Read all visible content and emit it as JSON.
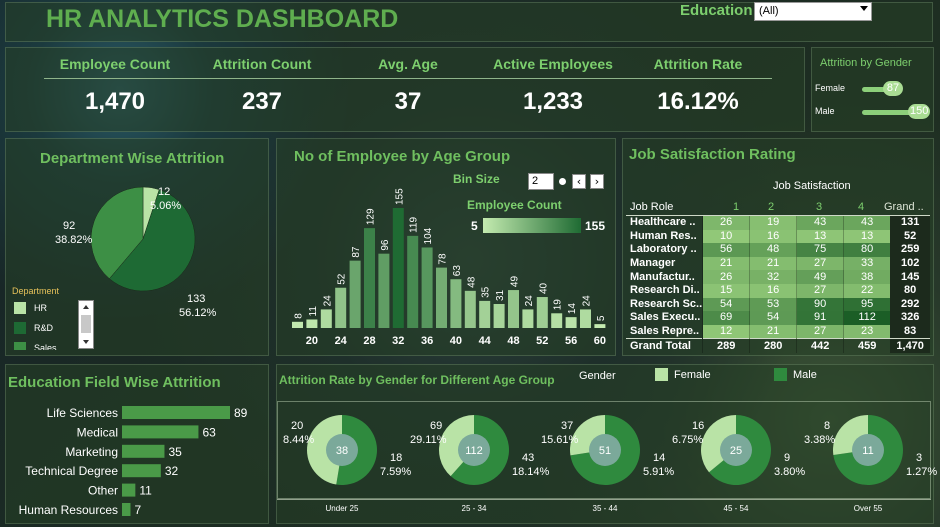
{
  "header": {
    "title": "HR ANALYTICS DASHBOARD",
    "filter_label": "Education",
    "filter_value": "(All)"
  },
  "kpis": [
    {
      "label": "Employee Count",
      "value": "1,470"
    },
    {
      "label": "Attrition Count",
      "value": "237"
    },
    {
      "label": "Avg. Age",
      "value": "37"
    },
    {
      "label": "Active Employees",
      "value": "1,233"
    },
    {
      "label": "Attrition Rate",
      "value": "16.12%"
    }
  ],
  "gender_panel": {
    "title": "Attrition by Gender",
    "rows": [
      {
        "label": "Female",
        "value": 87
      },
      {
        "label": "Male",
        "value": 150
      }
    ],
    "max": 150
  },
  "department": {
    "title": "Department Wise Attrition",
    "legend_title": "Department",
    "legend": [
      {
        "name": "HR",
        "color": "#b9e3a6"
      },
      {
        "name": "R&D",
        "color": "#1e6a34"
      },
      {
        "name": "Sales",
        "color": "#3d8f45"
      }
    ],
    "slices": [
      {
        "name": "HR",
        "value": 12,
        "pct": "5.06%",
        "color": "#b9e3a6"
      },
      {
        "name": "R&D",
        "value": 133,
        "pct": "56.12%",
        "color": "#1e6a34"
      },
      {
        "name": "Sales",
        "value": 92,
        "pct": "38.82%",
        "color": "#3d8f45"
      }
    ]
  },
  "age_group": {
    "title": "No of Employee by Age Group",
    "bin_label": "Bin Size",
    "bin_value": "2",
    "legend_label": "Employee Count",
    "legend_min": "5",
    "legend_max": "155"
  },
  "job_sat": {
    "title": "Job Satisfaction Rating",
    "header": "Job Satisfaction",
    "col_role": "Job Role",
    "cols": [
      "1",
      "2",
      "3",
      "4",
      "Grand .."
    ],
    "rows": [
      {
        "role": "Healthcare ..",
        "vals": [
          26,
          19,
          43,
          43
        ],
        "total": "131"
      },
      {
        "role": "Human Res..",
        "vals": [
          10,
          16,
          13,
          13
        ],
        "total": "52"
      },
      {
        "role": "Laboratory ..",
        "vals": [
          56,
          48,
          75,
          80
        ],
        "total": "259"
      },
      {
        "role": "Manager",
        "vals": [
          21,
          21,
          27,
          33
        ],
        "total": "102"
      },
      {
        "role": "Manufactur..",
        "vals": [
          26,
          32,
          49,
          38
        ],
        "total": "145"
      },
      {
        "role": "Research Di..",
        "vals": [
          15,
          16,
          27,
          22
        ],
        "total": "80"
      },
      {
        "role": "Research Sc..",
        "vals": [
          54,
          53,
          90,
          95
        ],
        "total": "292"
      },
      {
        "role": "Sales Execu..",
        "vals": [
          69,
          54,
          91,
          112
        ],
        "total": "326"
      },
      {
        "role": "Sales Repre..",
        "vals": [
          12,
          21,
          27,
          23
        ],
        "total": "83"
      }
    ],
    "grand": {
      "role": "Grand Total",
      "vals": [
        "289",
        "280",
        "442",
        "459"
      ],
      "total": "1,470"
    }
  },
  "edu": {
    "title": "Education Field Wise Attrition",
    "bars": [
      {
        "label": "Life Sciences",
        "value": 89
      },
      {
        "label": "Medical",
        "value": 63
      },
      {
        "label": "Marketing",
        "value": 35
      },
      {
        "label": "Technical Degree",
        "value": 32
      },
      {
        "label": "Other",
        "value": 11
      },
      {
        "label": "Human Resources",
        "value": 7
      }
    ]
  },
  "donuts": {
    "title": "Attrition Rate by Gender for Different Age Group",
    "legend_title": "Gender",
    "legend": [
      {
        "name": "Female",
        "color": "#b9e3a6"
      },
      {
        "name": "Male",
        "color": "#2f8a3e"
      }
    ],
    "groups": [
      {
        "label": "Under 25",
        "total": "38",
        "male": 20,
        "male_pct": "8.44%",
        "female": 18,
        "female_pct": "7.59%"
      },
      {
        "label": "25 - 34",
        "total": "112",
        "male": 69,
        "male_pct": "29.11%",
        "female": 43,
        "female_pct": "18.14%"
      },
      {
        "label": "35 - 44",
        "total": "51",
        "male": 37,
        "male_pct": "15.61%",
        "female": 14,
        "female_pct": "5.91%"
      },
      {
        "label": "45 - 54",
        "total": "25",
        "male": 16,
        "male_pct": "6.75%",
        "female": 9,
        "female_pct": "3.80%"
      },
      {
        "label": "Over 55",
        "total": "11",
        "male": 8,
        "male_pct": "3.38%",
        "female": 3,
        "female_pct": "1.27%"
      }
    ]
  },
  "chart_data": [
    {
      "type": "bar",
      "title": "No of Employee by Age Group",
      "categories": [
        "18",
        "20",
        "22",
        "24",
        "26",
        "28",
        "30",
        "32",
        "34",
        "36",
        "38",
        "40",
        "42",
        "44",
        "46",
        "48",
        "50",
        "52",
        "54",
        "56",
        "58",
        "60"
      ],
      "values": [
        8,
        11,
        24,
        52,
        87,
        129,
        96,
        155,
        119,
        104,
        78,
        63,
        48,
        35,
        31,
        49,
        24,
        40,
        19,
        14,
        24,
        5
      ],
      "ticks": [
        "20",
        "24",
        "28",
        "32",
        "36",
        "40",
        "44",
        "48",
        "52",
        "56",
        "60"
      ],
      "ylim": [
        0,
        155
      ]
    },
    {
      "type": "bar",
      "title": "Education Field Wise Attrition",
      "categories": [
        "Life Sciences",
        "Medical",
        "Marketing",
        "Technical Degree",
        "Other",
        "Human Resources"
      ],
      "values": [
        89,
        63,
        35,
        32,
        11,
        7
      ]
    },
    {
      "type": "pie",
      "title": "Department Wise Attrition",
      "categories": [
        "HR",
        "R&D",
        "Sales"
      ],
      "values": [
        12,
        133,
        92
      ]
    }
  ]
}
